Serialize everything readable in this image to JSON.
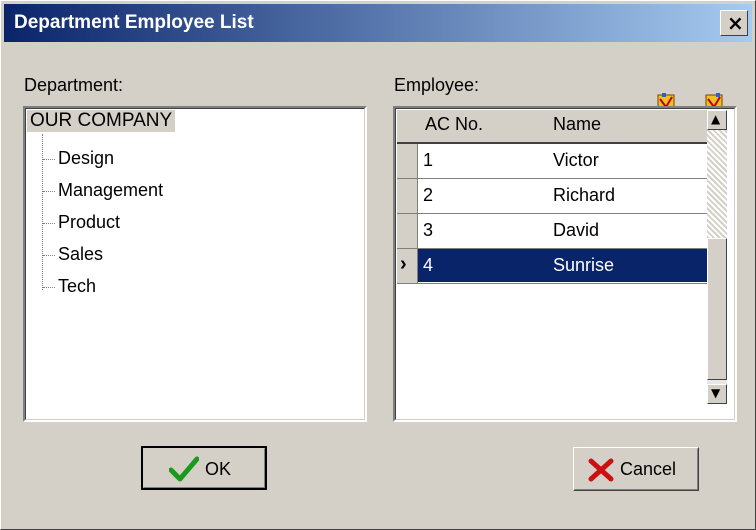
{
  "window": {
    "title": "Department Employee List",
    "close_glyph": "×"
  },
  "department": {
    "label": "Department:",
    "root": "OUR COMPANY",
    "children": [
      "Design",
      "Management",
      "Product",
      "Sales",
      "Tech"
    ]
  },
  "employee": {
    "label": "Employee:",
    "columns": {
      "ac_no": "AC No.",
      "name": "Name"
    },
    "rows": [
      {
        "ac": "1",
        "name": "Victor"
      },
      {
        "ac": "2",
        "name": "Richard"
      },
      {
        "ac": "3",
        "name": "David"
      },
      {
        "ac": "4",
        "name": "Sunrise"
      }
    ],
    "selected_indicator": "›"
  },
  "scroll": {
    "up_glyph": "▲",
    "down_glyph": "▼"
  },
  "buttons": {
    "ok_label": "OK",
    "cancel_label": "Cancel",
    "ok_icon": "check-icon",
    "cancel_icon": "x-icon"
  },
  "colors": {
    "title_start": "#0a246a",
    "title_end": "#a6caf0",
    "selection": "#0a246a",
    "face": "#d4d0c8"
  }
}
